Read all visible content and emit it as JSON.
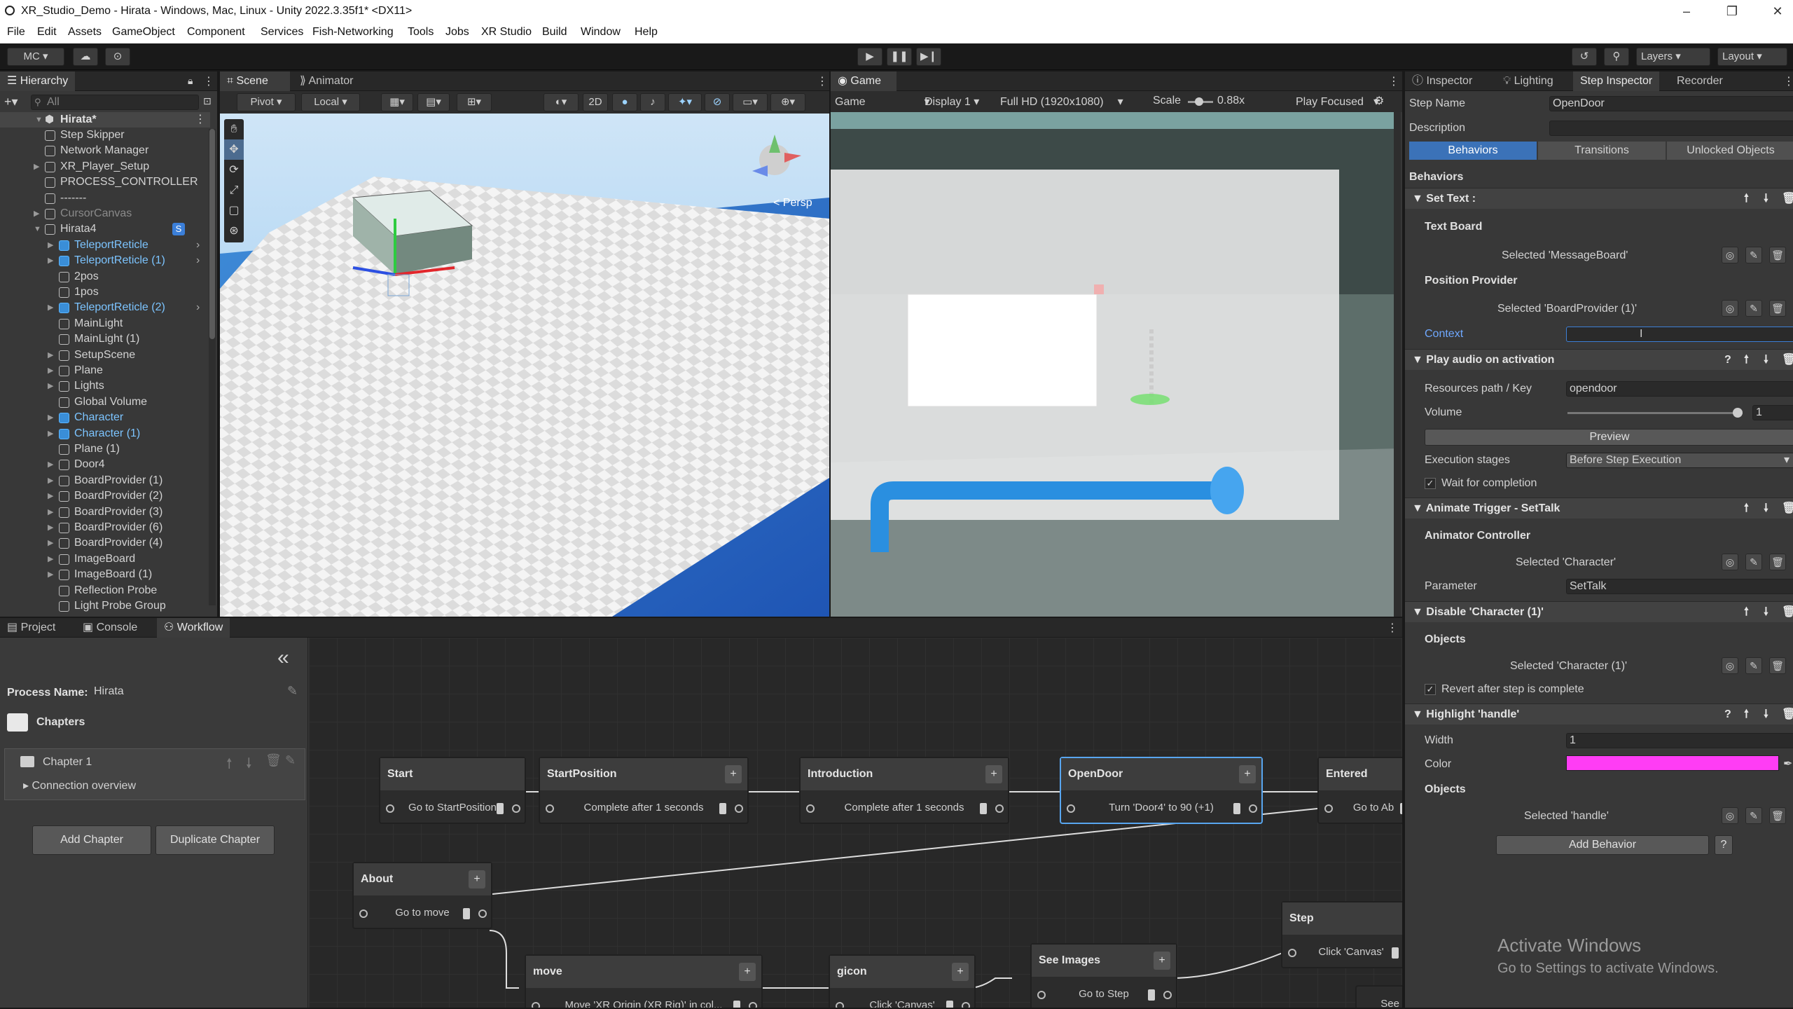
{
  "window": {
    "title": "XR_Studio_Demo - Hirata - Windows, Mac, Linux - Unity 2022.3.35f1* <DX11>",
    "minimize": "–",
    "restore": "❐",
    "close": "✕"
  },
  "menu": [
    "File",
    "Edit",
    "Assets",
    "GameObject",
    "Component",
    "Services",
    "Fish-Networking",
    "Tools",
    "Jobs",
    "XR Studio",
    "Build",
    "Window",
    "Help"
  ],
  "toolbar": {
    "account": "MC ▾",
    "layers": "Layers",
    "layout": "Layout"
  },
  "hierarchy": {
    "tab": "Hierarchy",
    "search_placeholder": "All",
    "scene_root": "Hirata*",
    "items": [
      {
        "label": "Step Skipper",
        "indent": 1,
        "prefab": false,
        "dim": false,
        "arrow": false
      },
      {
        "label": "Network Manager",
        "indent": 1,
        "prefab": false,
        "dim": false,
        "arrow": false
      },
      {
        "label": "XR_Player_Setup",
        "indent": 1,
        "prefab": false,
        "dim": false,
        "arrow": true
      },
      {
        "label": "PROCESS_CONTROLLER",
        "indent": 1,
        "prefab": false,
        "dim": false,
        "arrow": false
      },
      {
        "label": "-------",
        "indent": 1,
        "prefab": false,
        "dim": false,
        "arrow": false
      },
      {
        "label": "CursorCanvas",
        "indent": 1,
        "prefab": false,
        "dim": true,
        "arrow": true
      },
      {
        "label": "Hirata4",
        "indent": 1,
        "prefab": false,
        "dim": false,
        "arrow": true,
        "badge": "S"
      },
      {
        "label": "TeleportReticle",
        "indent": 2,
        "prefab": true,
        "dim": false,
        "arrow": true,
        "more": true
      },
      {
        "label": "TeleportReticle (1)",
        "indent": 2,
        "prefab": true,
        "dim": false,
        "arrow": true,
        "more": true
      },
      {
        "label": "2pos",
        "indent": 2,
        "prefab": false,
        "dim": false,
        "arrow": false
      },
      {
        "label": "1pos",
        "indent": 2,
        "prefab": false,
        "dim": false,
        "arrow": false
      },
      {
        "label": "TeleportReticle (2)",
        "indent": 2,
        "prefab": true,
        "dim": false,
        "arrow": true,
        "more": true
      },
      {
        "label": "MainLight",
        "indent": 2,
        "prefab": false,
        "dim": false,
        "arrow": false
      },
      {
        "label": "MainLight (1)",
        "indent": 2,
        "prefab": false,
        "dim": false,
        "arrow": false
      },
      {
        "label": "SetupScene",
        "indent": 2,
        "prefab": false,
        "dim": false,
        "arrow": true
      },
      {
        "label": "Plane",
        "indent": 2,
        "prefab": false,
        "dim": false,
        "arrow": true
      },
      {
        "label": "Lights",
        "indent": 2,
        "prefab": false,
        "dim": false,
        "arrow": true
      },
      {
        "label": "Global Volume",
        "indent": 2,
        "prefab": false,
        "dim": false,
        "arrow": false
      },
      {
        "label": "Character",
        "indent": 2,
        "prefab": true,
        "dim": false,
        "arrow": true
      },
      {
        "label": "Character (1)",
        "indent": 2,
        "prefab": true,
        "dim": false,
        "arrow": true
      },
      {
        "label": "Plane (1)",
        "indent": 2,
        "prefab": false,
        "dim": false,
        "arrow": false
      },
      {
        "label": "Door4",
        "indent": 2,
        "prefab": false,
        "dim": false,
        "arrow": true
      },
      {
        "label": "BoardProvider (1)",
        "indent": 2,
        "prefab": false,
        "dim": false,
        "arrow": true
      },
      {
        "label": "BoardProvider (2)",
        "indent": 2,
        "prefab": false,
        "dim": false,
        "arrow": true
      },
      {
        "label": "BoardProvider (3)",
        "indent": 2,
        "prefab": false,
        "dim": false,
        "arrow": true
      },
      {
        "label": "BoardProvider (6)",
        "indent": 2,
        "prefab": false,
        "dim": false,
        "arrow": true
      },
      {
        "label": "BoardProvider (4)",
        "indent": 2,
        "prefab": false,
        "dim": false,
        "arrow": true
      },
      {
        "label": "ImageBoard",
        "indent": 2,
        "prefab": false,
        "dim": false,
        "arrow": true
      },
      {
        "label": "ImageBoard (1)",
        "indent": 2,
        "prefab": false,
        "dim": false,
        "arrow": true
      },
      {
        "label": "Reflection Probe",
        "indent": 2,
        "prefab": false,
        "dim": false,
        "arrow": false
      },
      {
        "label": "Light Probe Group",
        "indent": 2,
        "prefab": false,
        "dim": false,
        "arrow": false
      }
    ]
  },
  "scene": {
    "tabs": [
      "Scene",
      "Animator"
    ],
    "pivot": "Pivot",
    "local": "Local",
    "mode2d": "2D",
    "persp": "< Persp"
  },
  "game": {
    "tab": "Game",
    "view": "Game",
    "display": "Display 1",
    "resolution": "Full HD (1920x1080)",
    "scale_label": "Scale",
    "scale_value": "0.88x",
    "play_mode": "Play Focused"
  },
  "bottom_tabs": [
    "Project",
    "Console",
    "Workflow"
  ],
  "workflow": {
    "collapse": "«",
    "process_label": "Process Name:",
    "process_name": "Hirata",
    "chapters_label": "Chapters",
    "chapter": "Chapter 1",
    "connection": "Connection overview",
    "add_chapter": "Add Chapter",
    "duplicate_chapter": "Duplicate Chapter",
    "nodes": [
      {
        "title": "Start",
        "body": "Go to StartPosition",
        "plus": false,
        "selected": false
      },
      {
        "title": "StartPosition",
        "body": "Complete after 1 seconds",
        "plus": true,
        "selected": false
      },
      {
        "title": "Introduction",
        "body": "Complete after 1 seconds",
        "plus": true,
        "selected": false
      },
      {
        "title": "OpenDoor",
        "body": "Turn 'Door4' to 90 (+1)",
        "plus": true,
        "selected": true
      },
      {
        "title": "Entered",
        "body": "Go to Ab",
        "plus": false,
        "selected": false
      },
      {
        "title": "About",
        "body": "Go to move",
        "plus": true,
        "selected": false
      },
      {
        "title": "move",
        "body": "Move 'XR Origin (XR Rig)' in col...",
        "plus": true,
        "selected": false
      },
      {
        "title": "gicon",
        "body": "Click 'Canvas'",
        "plus": true,
        "selected": false
      },
      {
        "title": "See Images",
        "body": "Go to Step",
        "plus": true,
        "selected": false
      },
      {
        "title": "Step",
        "body": "Click 'Canvas'",
        "plus": false,
        "selected": false
      },
      {
        "title": "",
        "body": "See Im",
        "plus": false,
        "selected": false
      }
    ]
  },
  "inspector": {
    "tabs": [
      "Inspector",
      "Lighting",
      "Step Inspector",
      "Recorder"
    ],
    "step_name_label": "Step Name",
    "step_name": "OpenDoor",
    "description_label": "Description",
    "subtabs": [
      "Behaviors",
      "Transitions",
      "Unlocked Objects"
    ],
    "behaviors_label": "Behaviors",
    "set_text": {
      "header": "Set Text :",
      "text_board": "Text Board",
      "text_board_value": "Selected 'MessageBoard'",
      "position_provider": "Position Provider",
      "position_value": "Selected 'BoardProvider (1)'",
      "context": "Context"
    },
    "play_audio": {
      "header": "Play audio on activation",
      "resources_label": "Resources path / Key",
      "resources_value": "opendoor",
      "volume_label": "Volume",
      "volume_value": "1",
      "volume_level": 1.0,
      "preview": "Preview",
      "exec_label": "Execution stages",
      "exec_value": "Before Step Execution",
      "wait_label": "Wait for completion"
    },
    "animate": {
      "header": "Animate Trigger - SetTalk",
      "controller": "Animator Controller",
      "controller_value": "Selected 'Character'",
      "parameter_label": "Parameter",
      "parameter_value": "SetTalk"
    },
    "disable": {
      "header": "Disable 'Character (1)'",
      "objects": "Objects",
      "objects_value": "Selected 'Character (1)'",
      "revert": "Revert after step is complete"
    },
    "highlight": {
      "header": "Highlight 'handle'",
      "width_label": "Width",
      "width_value": "1",
      "color_label": "Color",
      "color": "#ff3df5",
      "objects": "Objects",
      "objects_value": "Selected 'handle'"
    },
    "add_behavior": "Add Behavior",
    "help": "?"
  },
  "watermark": {
    "line1": "Activate Windows",
    "line2": "Go to Settings to activate Windows."
  }
}
